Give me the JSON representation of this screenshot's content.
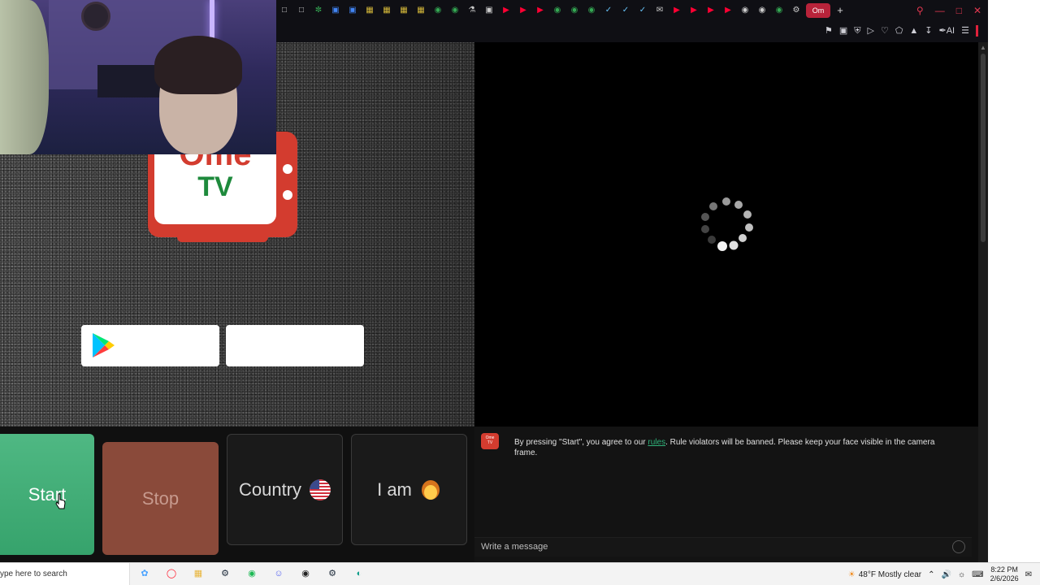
{
  "browser": {
    "active_tab_label": "Om",
    "new_tab_symbol": "+",
    "tab_icons": [
      "page",
      "page",
      "chatgpt",
      "page",
      "page",
      "bookmark",
      "bookmark",
      "bookmark",
      "bookmark",
      "google",
      "google",
      "steam-store",
      "notion",
      "youtube",
      "youtube",
      "youtube",
      "google",
      "google",
      "google",
      "steam",
      "steam",
      "steam",
      "mail",
      "youtube",
      "youtube",
      "youtube",
      "youtube",
      "chrome",
      "chrome",
      "google",
      "settings"
    ],
    "window_controls": [
      "search",
      "minimize",
      "maximize",
      "close"
    ],
    "toolbar_icons": [
      "bookmark",
      "screenshot",
      "vpn",
      "play",
      "heart",
      "extensions",
      "lock",
      "download",
      "ai"
    ],
    "toolbar_ai_label": "AI",
    "accent_color": "#e0213b"
  },
  "page": {
    "logo": {
      "line1": "Ome",
      "line2": "TV",
      "red": "#d33c2f",
      "green": "#1e8a3c"
    },
    "store_buttons": [
      {
        "name": "google-play",
        "label": ""
      },
      {
        "name": "app-store",
        "label": ""
      }
    ],
    "controls": {
      "start_label": "Start",
      "stop_label": "Stop",
      "country_label": "Country",
      "country_flag": "us-flag",
      "iam_label": "I am",
      "iam_icon": "person-emoji",
      "start_color": "#3fad75",
      "stop_color": "#8a4a3a"
    },
    "chat": {
      "notice_before": "By pressing \"Start\", you agree to our ",
      "notice_link": "rules",
      "notice_after": ". Rule violators will be banned. Please keep your face visible in the camera frame.",
      "input_placeholder": "Write a message",
      "link_color": "#2fb37a"
    }
  },
  "taskbar": {
    "search_text": "ype here to search",
    "apps": [
      "copilot",
      "opera",
      "file-explorer",
      "steam",
      "spotify",
      "discord",
      "obs",
      "steam",
      "edge"
    ],
    "weather": "48°F  Mostly clear",
    "time": "8:22 PM",
    "date": "2/6/2026"
  }
}
